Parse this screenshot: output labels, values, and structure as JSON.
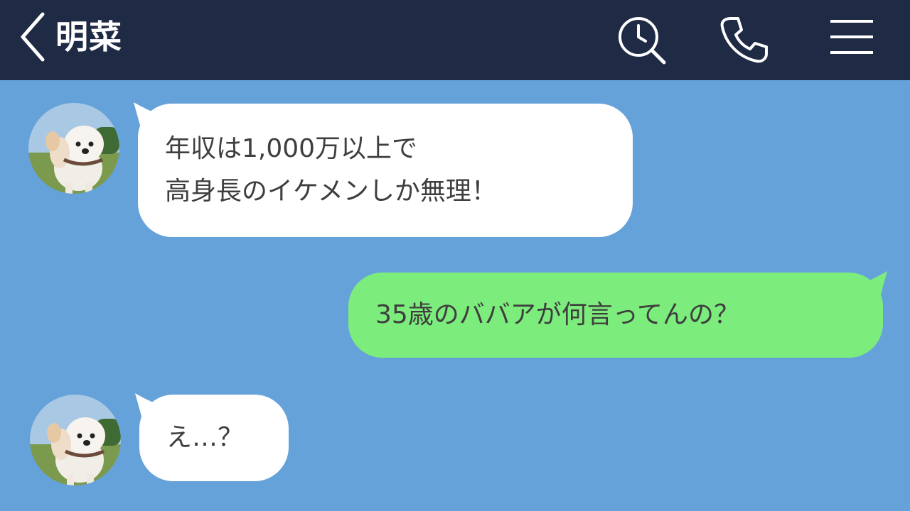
{
  "header": {
    "title": "明菜",
    "icons": [
      "chevron-left-icon",
      "search-history-icon",
      "phone-icon",
      "menu-icon"
    ],
    "background": "#1f2a45"
  },
  "chat": {
    "background": "#66a2da",
    "incoming_bubble_color": "#ffffff",
    "outgoing_bubble_color": "#7ced7c",
    "messages": [
      {
        "sender": "contact",
        "avatar": "dog-avatar",
        "lines": [
          "年収は1,000万以上で",
          "高身長のイケメンしか無理！"
        ]
      },
      {
        "sender": "me",
        "lines": [
          "35歳のババアが何言ってんの？"
        ]
      },
      {
        "sender": "contact",
        "avatar": "dog-avatar",
        "lines": [
          "え…？"
        ]
      }
    ]
  }
}
